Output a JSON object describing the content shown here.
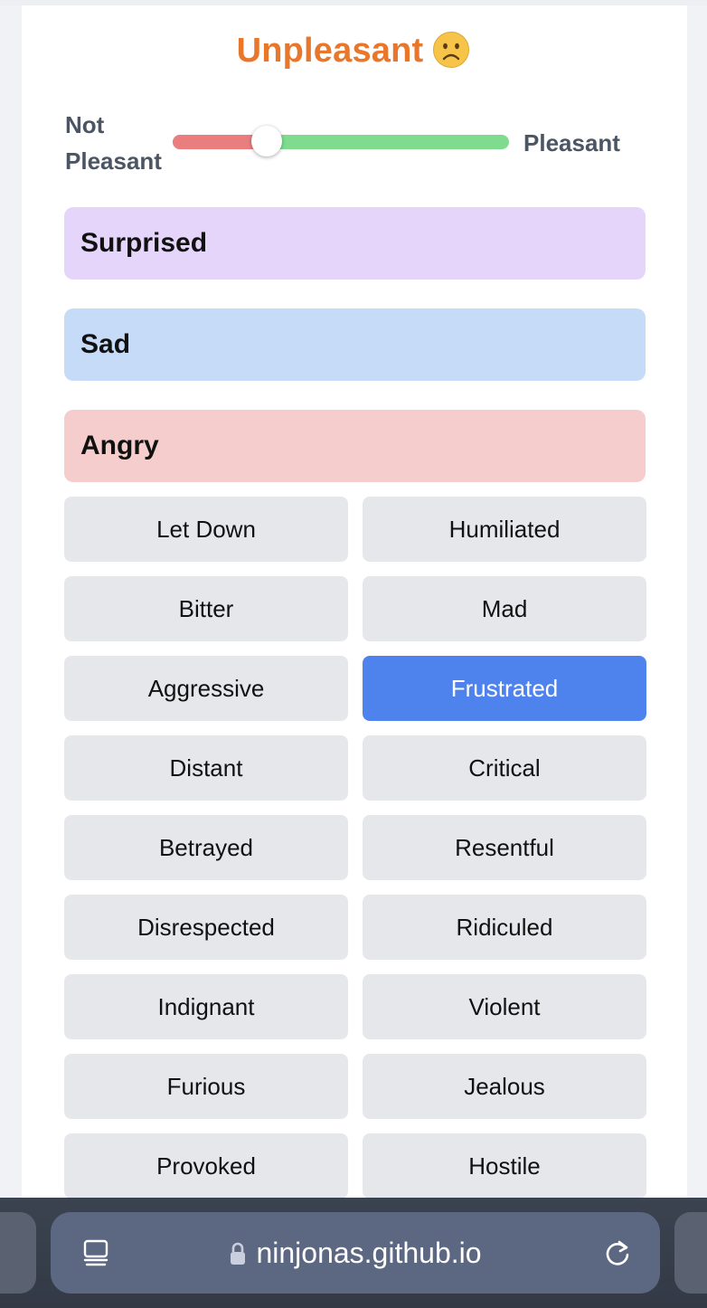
{
  "mood": {
    "label": "Unpleasant",
    "emoji_icon": "frowning-face-icon",
    "color": "#e9772b"
  },
  "scale": {
    "low_label": "Not Pleasant",
    "high_label": "Pleasant",
    "value": 0.28,
    "low_color": "#ea7e7e",
    "high_color": "#7fdc8f"
  },
  "categories": [
    {
      "label": "Surprised",
      "color": "#e5d5fa"
    },
    {
      "label": "Sad",
      "color": "#c6dbf8"
    },
    {
      "label": "Angry",
      "color": "#f5cdcd"
    }
  ],
  "emotions": [
    {
      "label": "Let Down",
      "selected": false
    },
    {
      "label": "Humiliated",
      "selected": false
    },
    {
      "label": "Bitter",
      "selected": false
    },
    {
      "label": "Mad",
      "selected": false
    },
    {
      "label": "Aggressive",
      "selected": false
    },
    {
      "label": "Frustrated",
      "selected": true
    },
    {
      "label": "Distant",
      "selected": false
    },
    {
      "label": "Critical",
      "selected": false
    },
    {
      "label": "Betrayed",
      "selected": false
    },
    {
      "label": "Resentful",
      "selected": false
    },
    {
      "label": "Disrespected",
      "selected": false
    },
    {
      "label": "Ridiculed",
      "selected": false
    },
    {
      "label": "Indignant",
      "selected": false
    },
    {
      "label": "Violent",
      "selected": false
    },
    {
      "label": "Furious",
      "selected": false
    },
    {
      "label": "Jealous",
      "selected": false
    },
    {
      "label": "Provoked",
      "selected": false
    },
    {
      "label": "Hostile",
      "selected": false
    }
  ],
  "selected_color": "#4e83ee",
  "browser": {
    "url": "ninjonas.github.io",
    "tabs_icon": "tabs-icon",
    "lock_icon": "lock-icon",
    "reload_icon": "reload-icon"
  }
}
